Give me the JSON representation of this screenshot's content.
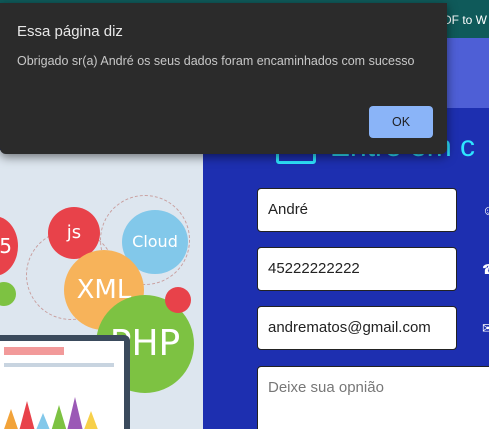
{
  "browser": {
    "tab_partial": "PDF to W"
  },
  "dialog": {
    "title": "Essa página diz",
    "message": "Obrigado sr(a) André  os seus dados foram encaminhados com sucesso",
    "ok_label": "OK"
  },
  "page": {
    "heading_partial": "Entre em c",
    "illustration": {
      "bubble_left": "5",
      "bubble_js": "js",
      "bubble_cloud": "Cloud",
      "bubble_xml": "XML",
      "bubble_php": "PHP"
    },
    "form": {
      "name_value": "André",
      "phone_value": "45222222222",
      "email_value": "andrematos@gmail.com",
      "opinion_placeholder": "Deixe sua opnião"
    }
  },
  "colors": {
    "panel": "#1d2fb0",
    "heading": "#2ee6ff",
    "ok_button": "#8ab4f8",
    "dialog": "#2b2b2b"
  },
  "icons": [
    "user-icon",
    "phone-icon",
    "envelope-icon"
  ]
}
